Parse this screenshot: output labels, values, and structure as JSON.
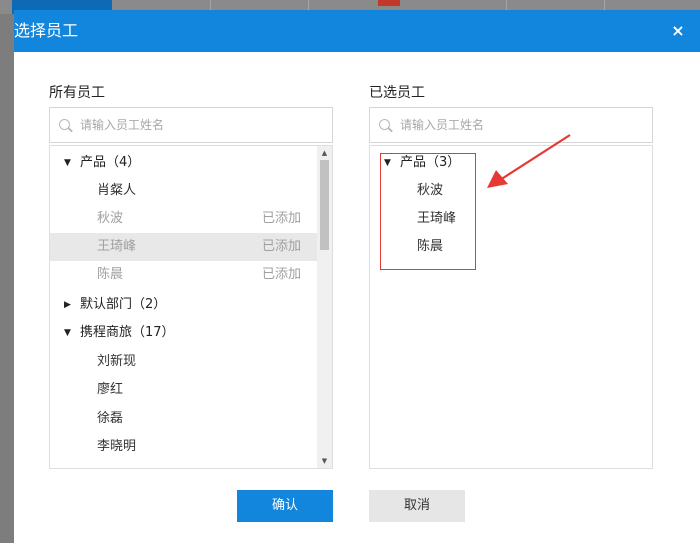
{
  "dialog": {
    "title": "选择员工",
    "close_label": "×"
  },
  "left_panel": {
    "title": "所有员工",
    "search_placeholder": "请输入员工姓名",
    "groups": [
      {
        "label": "产品（4）",
        "expanded": true,
        "items": [
          {
            "name": "肖粲人",
            "status": ""
          },
          {
            "name": "秋波",
            "status": "已添加"
          },
          {
            "name": "王琦峰",
            "status": "已添加"
          },
          {
            "name": "陈晨",
            "status": "已添加"
          }
        ]
      },
      {
        "label": "默认部门（2）",
        "expanded": false,
        "items": []
      },
      {
        "label": "携程商旅（17）",
        "expanded": true,
        "items": [
          {
            "name": "刘新现",
            "status": ""
          },
          {
            "name": "廖红",
            "status": ""
          },
          {
            "name": "徐磊",
            "status": ""
          },
          {
            "name": "李晓明",
            "status": ""
          }
        ]
      }
    ]
  },
  "right_panel": {
    "title": "已选员工",
    "search_placeholder": "请输入员工姓名",
    "groups": [
      {
        "label": "产品（3）",
        "expanded": true,
        "items": [
          {
            "name": "秋波"
          },
          {
            "name": "王琦峰"
          },
          {
            "name": "陈晨"
          }
        ]
      }
    ]
  },
  "buttons": {
    "confirm_label": "确认",
    "cancel_label": "取消"
  },
  "icons": {
    "expanded": "▼",
    "collapsed": "▶",
    "scroll_up": "▲",
    "scroll_down": "▼"
  },
  "colors": {
    "primary": "#1186dc",
    "annotation": "#e53935"
  }
}
